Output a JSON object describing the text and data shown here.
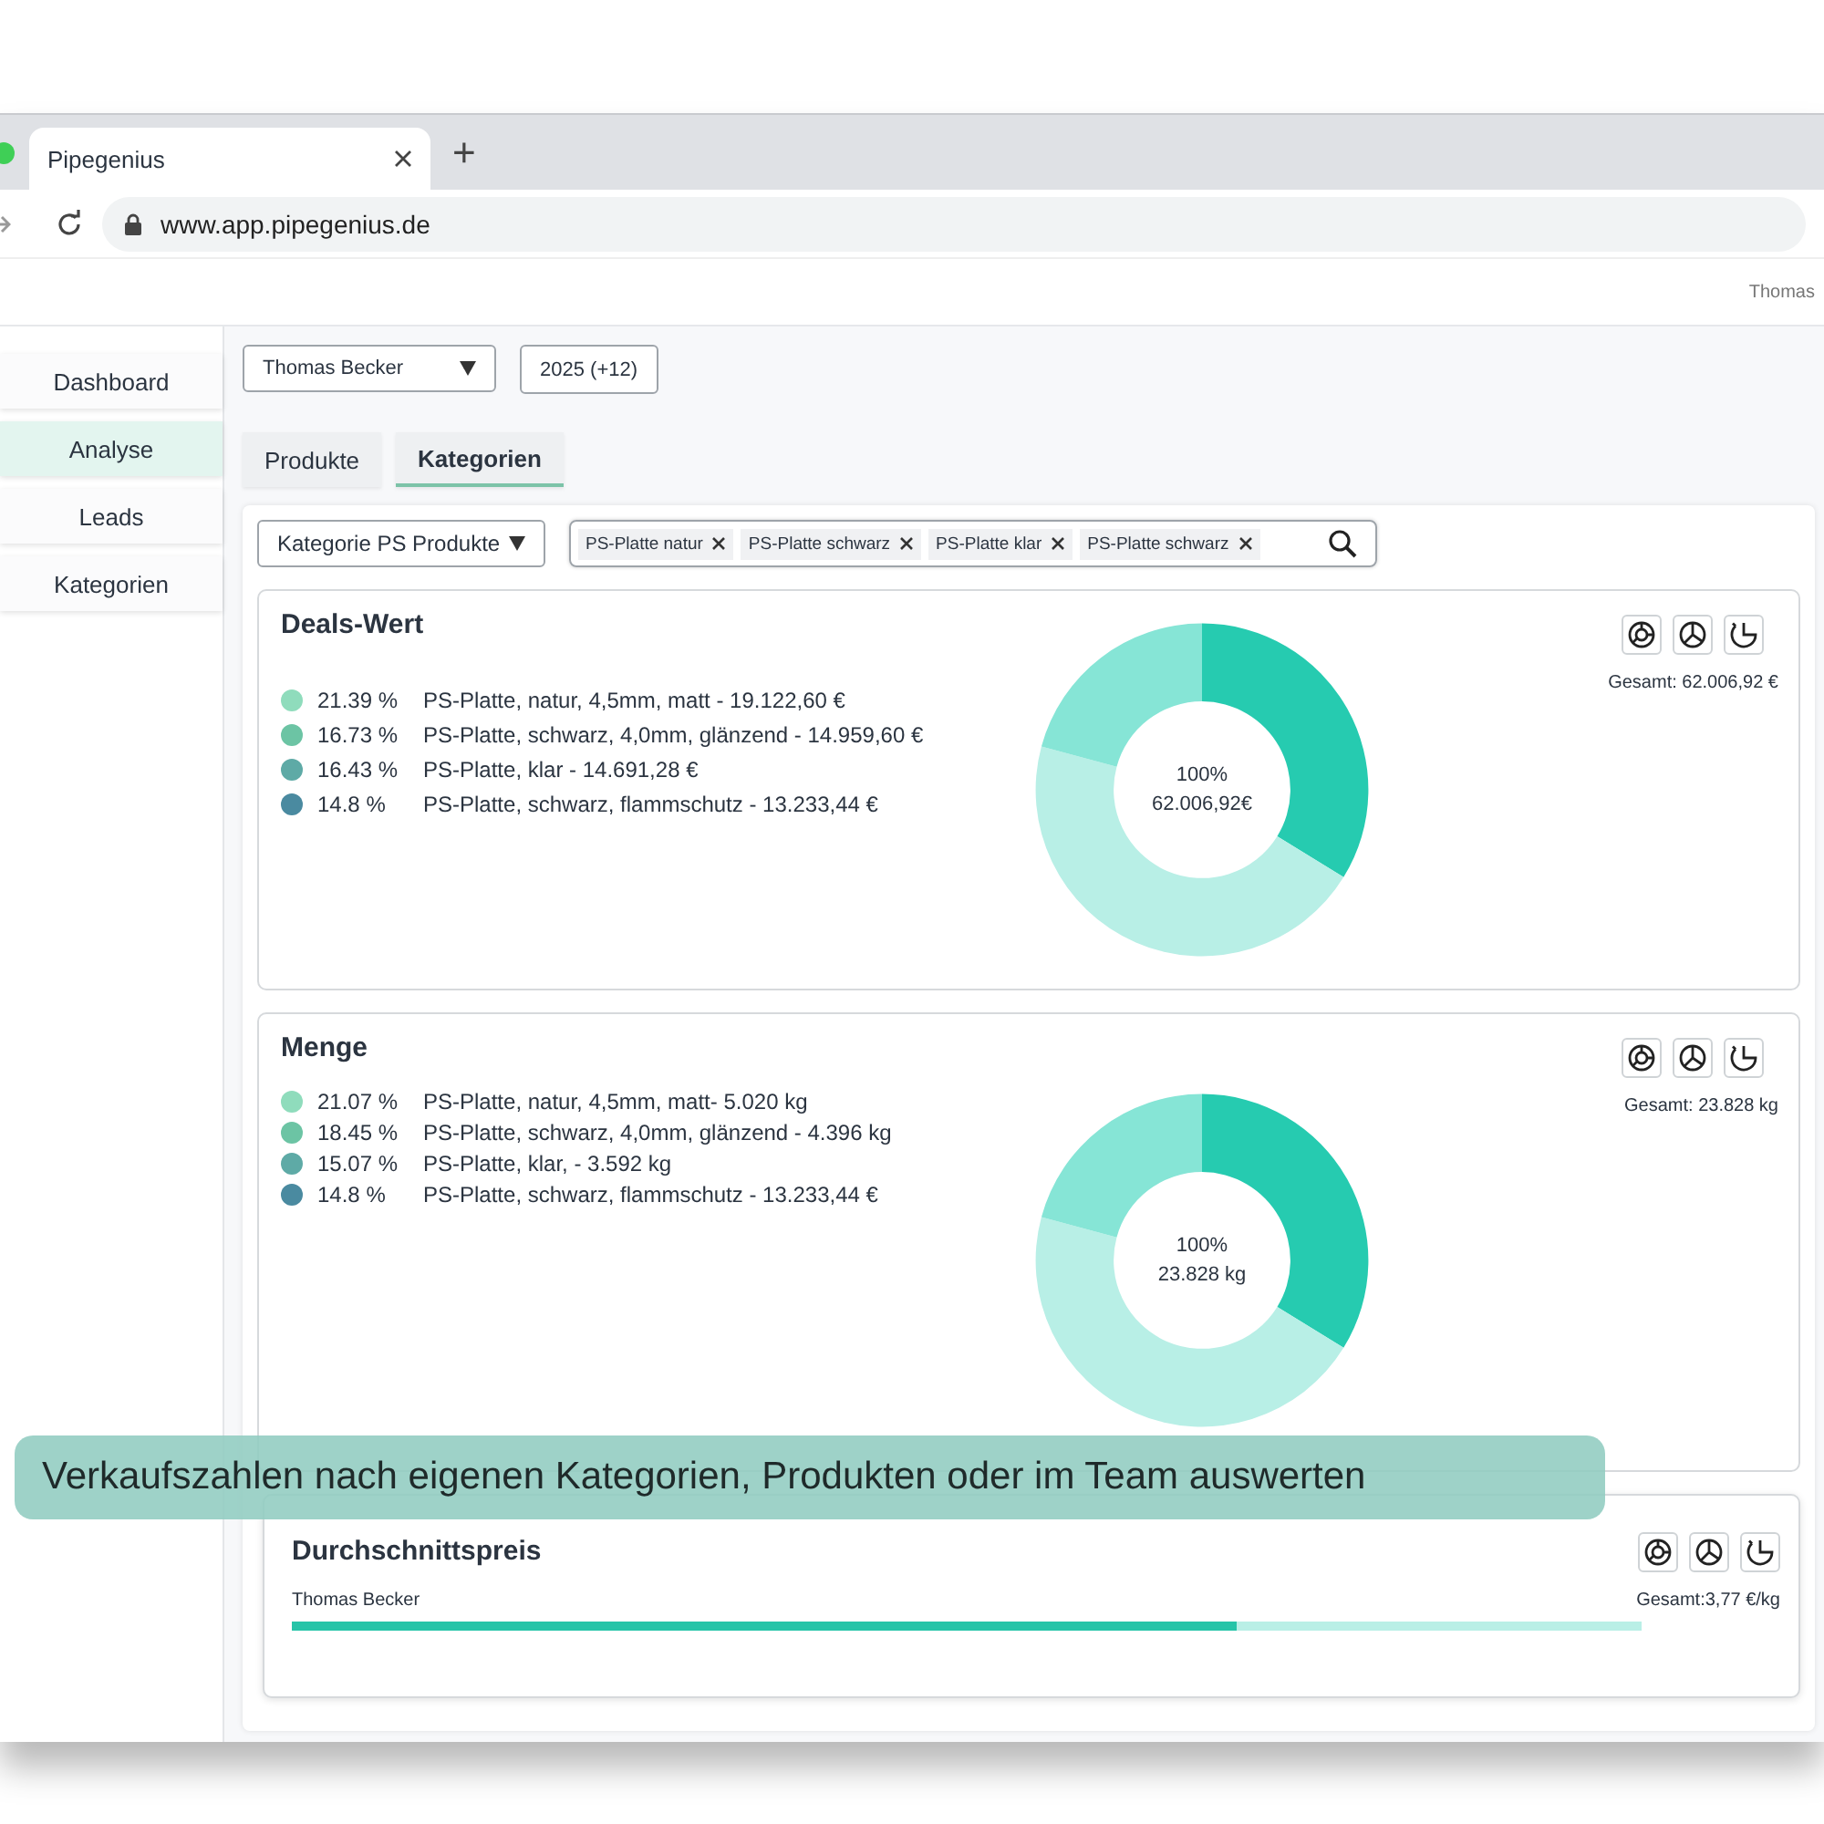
{
  "browser": {
    "tab_title": "Pipegenius",
    "new_tab": "+",
    "url": "www.app.pipegenius.de"
  },
  "header": {
    "user": "Thomas"
  },
  "sidebar": {
    "items": [
      {
        "label": "Dashboard",
        "selected": false
      },
      {
        "label": "Analyse",
        "selected": true
      },
      {
        "label": "Leads",
        "selected": false
      },
      {
        "label": "Kategorien",
        "selected": false
      }
    ]
  },
  "filters": {
    "person": "Thomas Becker",
    "year": "2025 (+12)"
  },
  "tabs": [
    {
      "label": "Produkte",
      "selected": false
    },
    {
      "label": "Kategorien",
      "selected": true
    }
  ],
  "category_select": "Kategorie PS Produkte",
  "tags": [
    "PS-Platte natur",
    "PS-Platte schwarz",
    "PS-Platte klar",
    "PS-Platte schwarz"
  ],
  "cards": [
    {
      "kind": "donut",
      "title": "Deals-Wert",
      "total": "Gesamt: 62.006,92 €",
      "center": [
        "100%",
        "62.006,92€"
      ],
      "legend": [
        {
          "percent": "21.39 %",
          "text": "PS-Platte, natur, 4,5mm, matt - 19.122,60 €",
          "color": "#8fdcbc"
        },
        {
          "percent": "16.73 %",
          "text": "PS-Platte, schwarz, 4,0mm, glänzend - 14.959,60 €",
          "color": "#6cc4a4"
        },
        {
          "percent": "16.43 %",
          "text": "PS-Platte, klar - 14.691,28 €",
          "color": "#5eaaa6"
        },
        {
          "percent": "14.8 %",
          "text": "PS-Platte, schwarz, flammschutz - 13.233,44 €",
          "color": "#4a8aa0"
        }
      ]
    },
    {
      "kind": "donut",
      "title": "Menge",
      "total": "Gesamt: 23.828 kg",
      "center": [
        "100%",
        "23.828 kg"
      ],
      "legend": [
        {
          "percent": "21.07 %",
          "text": "PS-Platte, natur, 4,5mm, matt- 5.020 kg",
          "color": "#8fdcbc"
        },
        {
          "percent": "18.45 %",
          "text": "PS-Platte, schwarz, 4,0mm, glänzend - 4.396 kg",
          "color": "#6cc4a4"
        },
        {
          "percent": "15.07 %",
          "text": "PS-Platte, klar,  - 3.592 kg",
          "color": "#5eaaa6"
        },
        {
          "percent": "14.8 %",
          "text": "PS-Platte, schwarz, flammschutz - 13.233,44 €",
          "color": "#4a8aa0"
        }
      ]
    },
    {
      "kind": "bar",
      "title": "Durchschnittspreis",
      "total": "Gesamt:3,77 €/kg",
      "label": "Thomas Becker",
      "level": 0.7
    }
  ],
  "caption": "Verkaufszahlen nach eigenen Kategorien, Produkten oder im Team auswerten"
}
